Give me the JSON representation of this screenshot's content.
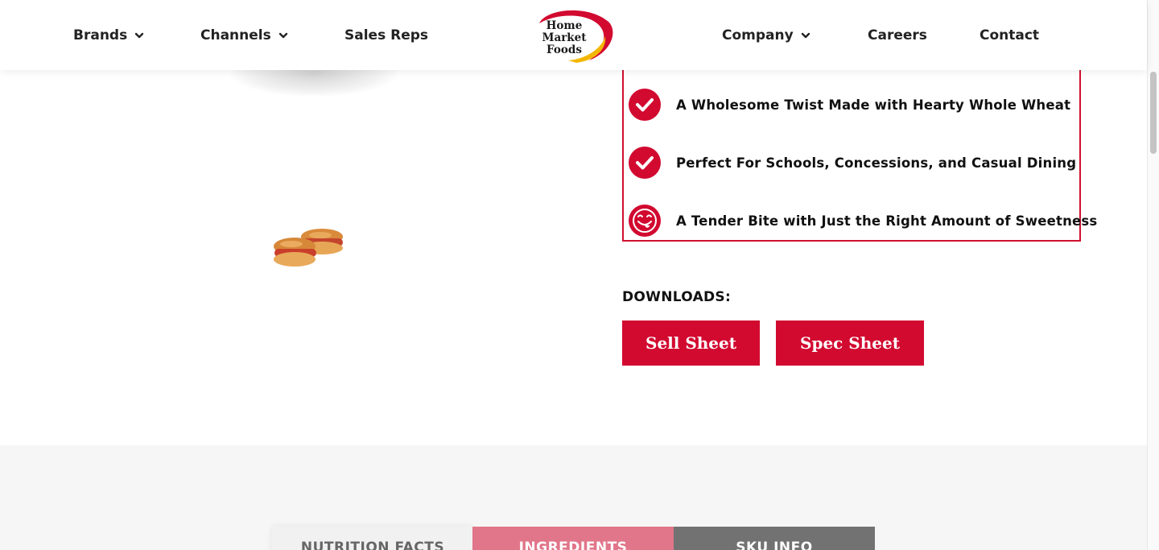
{
  "nav": {
    "left": [
      {
        "label": "Brands",
        "has_dropdown": true
      },
      {
        "label": "Channels",
        "has_dropdown": true
      },
      {
        "label": "Sales Reps",
        "has_dropdown": false
      }
    ],
    "right": [
      {
        "label": "Company",
        "has_dropdown": true
      },
      {
        "label": "Careers",
        "has_dropdown": false
      },
      {
        "label": "Contact",
        "has_dropdown": false
      }
    ],
    "logo": {
      "line1": "Home",
      "line2": "Market",
      "line3": "Foods"
    }
  },
  "features": [
    {
      "icon": "check-circle-icon",
      "text": "A Wholesome Twist Made with Hearty Whole Wheat"
    },
    {
      "icon": "check-circle-icon",
      "text": "Perfect For Schools, Concessions, and Casual Dining"
    },
    {
      "icon": "smiley-face-icon",
      "text": "A Tender Bite with Just the Right Amount of Sweetness"
    }
  ],
  "downloads": {
    "label": "DOWNLOADS:",
    "buttons": [
      "Sell Sheet",
      "Spec Sheet"
    ]
  },
  "tabs": [
    "NUTRITION FACTS",
    "INGREDIENTS",
    "SKU INFO"
  ],
  "colors": {
    "brand_red": "#d20a30",
    "tab_ingredients": "#e1768a",
    "tab_sku": "#727272",
    "logo_yellow": "#f2b705"
  }
}
